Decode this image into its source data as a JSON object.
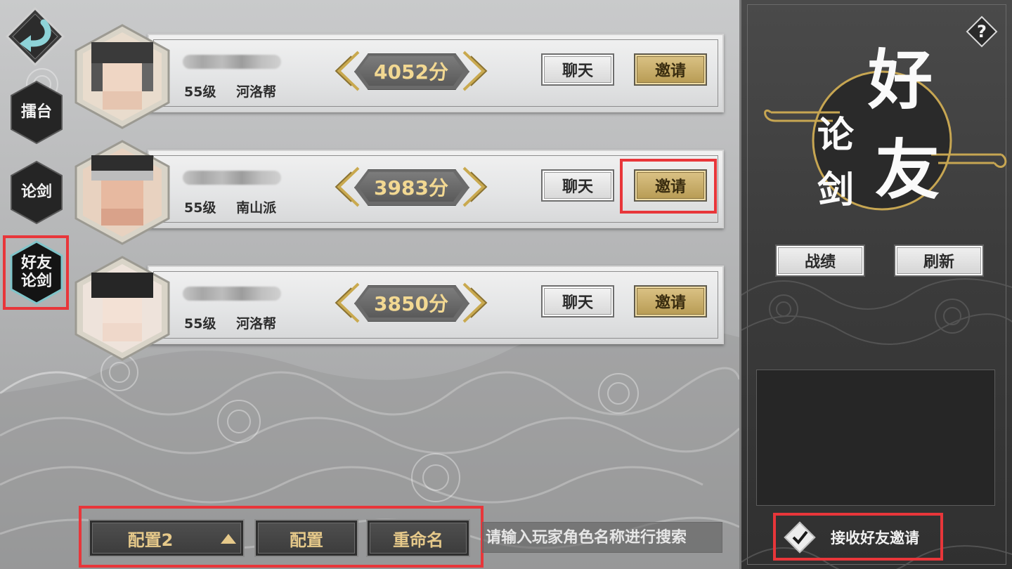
{
  "sidebar": {
    "back_icon": "back-arrow-icon",
    "tabs": [
      {
        "label": "擂台"
      },
      {
        "label": "论剑"
      },
      {
        "label": "好友\n论剑"
      }
    ]
  },
  "friends": [
    {
      "level": "55级",
      "guild": "河洛帮",
      "score": "4052分",
      "chat_label": "聊天",
      "invite_label": "邀请"
    },
    {
      "level": "55级",
      "guild": "南山派",
      "score": "3983分",
      "chat_label": "聊天",
      "invite_label": "邀请"
    },
    {
      "level": "55级",
      "guild": "河洛帮",
      "score": "3850分",
      "chat_label": "聊天",
      "invite_label": "邀请"
    }
  ],
  "bottom_bar": {
    "config_select": "配置2",
    "config_button": "配置",
    "rename_button": "重命名",
    "search_placeholder": "请输入玩家角色名称进行搜索"
  },
  "right_panel": {
    "title_big": [
      "好",
      "友"
    ],
    "title_small": [
      "论",
      "剑"
    ],
    "help_label": "?",
    "record_button": "战绩",
    "refresh_button": "刷新",
    "accept_invites_label": "接收好友邀请",
    "accept_invites_checked": true
  },
  "colors": {
    "invite_gold": "#c7ad68",
    "score_text": "#f2d892",
    "highlight_red": "#e8363a"
  }
}
